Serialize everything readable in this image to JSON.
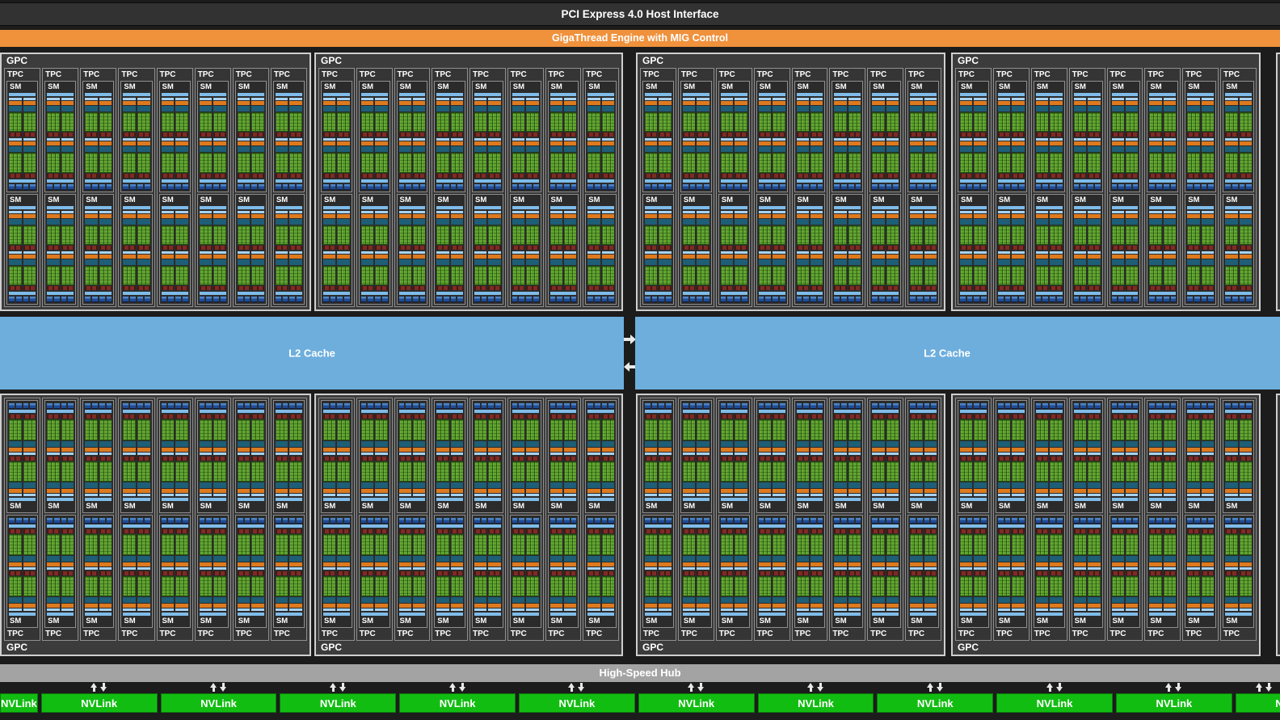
{
  "diagram": {
    "pci_label": "PCI Express 4.0 Host Interface",
    "gigathread_label": "GigaThread Engine with MIG Control",
    "hub_label": "High-Speed Hub"
  },
  "labels": {
    "gpc": "GPC",
    "tpc": "TPC",
    "sm": "SM",
    "l2_cache": "L2 Cache",
    "nvlink": "NVLink"
  },
  "structure": {
    "gpc_rows": 2,
    "gpcs_per_row": 4,
    "tpcs_per_gpc": 8,
    "sms_per_tpc": 2,
    "processing_blocks_per_sm": 4,
    "l2_cache_partitions": 2,
    "nvlink_blocks_full": 10,
    "nvlink_blocks_partial": 2
  },
  "colors": {
    "bg": "#1c1c1c",
    "pci_bar": "#323232",
    "orange": "#f0913c",
    "hub_gray": "#a3a3a3",
    "gpc_bg": "#3c3c3c",
    "tpc_bg": "#353535",
    "sm_bg": "#2b2b2b",
    "border_light": "#cfcfcf",
    "border_mid": "#8f8f8f",
    "blue_bar": "#7fbce9",
    "blue_bar_light": "#a7d2f1",
    "sm_orange": "#dd7a1f",
    "teal": "#1e5e76",
    "green": "#5fa32c",
    "red_bar": "#7e2b24",
    "navy_seg": "#1f4c96",
    "l2_blue": "#6daedd",
    "nvlink_green": "#12bd12",
    "arrow": "#e9e9e9"
  }
}
